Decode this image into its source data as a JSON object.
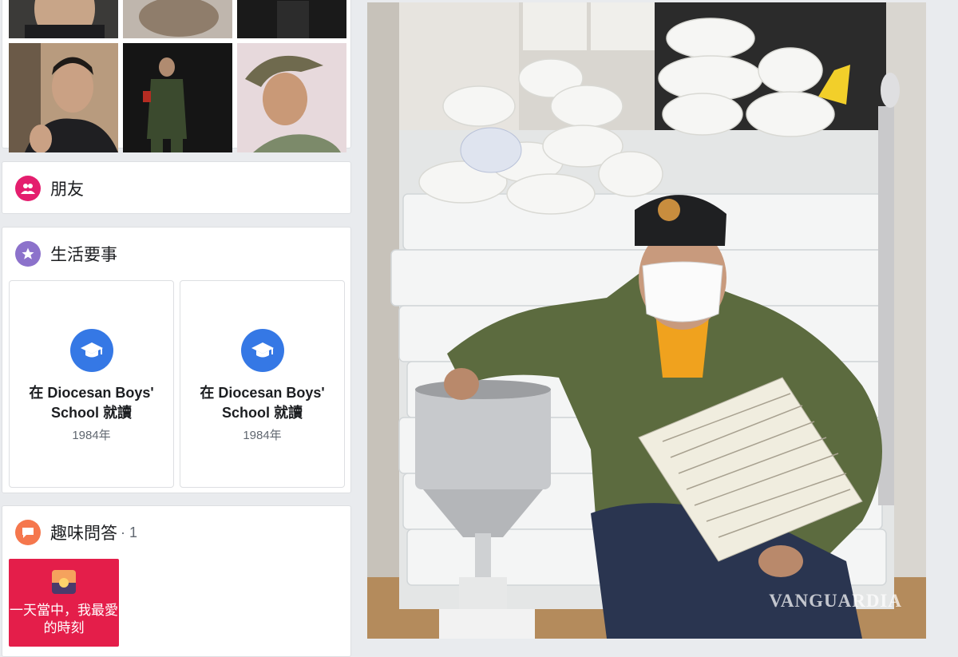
{
  "photos_card": {
    "thumbs": [
      {
        "label": "profile-photo-1"
      },
      {
        "label": "profile-photo-2"
      },
      {
        "label": "profile-photo-3"
      },
      {
        "label": "profile-photo-4"
      },
      {
        "label": "profile-photo-5"
      },
      {
        "label": "profile-photo-6"
      }
    ]
  },
  "friends_card": {
    "title": "朋友",
    "icon": "friends-icon",
    "icon_color": "#e41e6e"
  },
  "life_events_card": {
    "title": "生活要事",
    "icon": "star-icon",
    "icon_color": "#8c72cb",
    "events": [
      {
        "title": "在 Diocesan Boys' School 就讀",
        "year": "1984年",
        "icon": "graduation-cap-icon"
      },
      {
        "title": "在 Diocesan Boys' School 就讀",
        "year": "1984年",
        "icon": "graduation-cap-icon"
      }
    ]
  },
  "quiz_card": {
    "title": "趣味問答",
    "count": "· 1",
    "icon": "speech-bubble-icon",
    "icon_color": "#f5774d",
    "quiz": {
      "text": "一天當中，我最愛的時刻",
      "icon": "sunset-icon",
      "bg_color": "#e41e4a"
    }
  },
  "post": {
    "watermark": "VANGUARDIA"
  }
}
